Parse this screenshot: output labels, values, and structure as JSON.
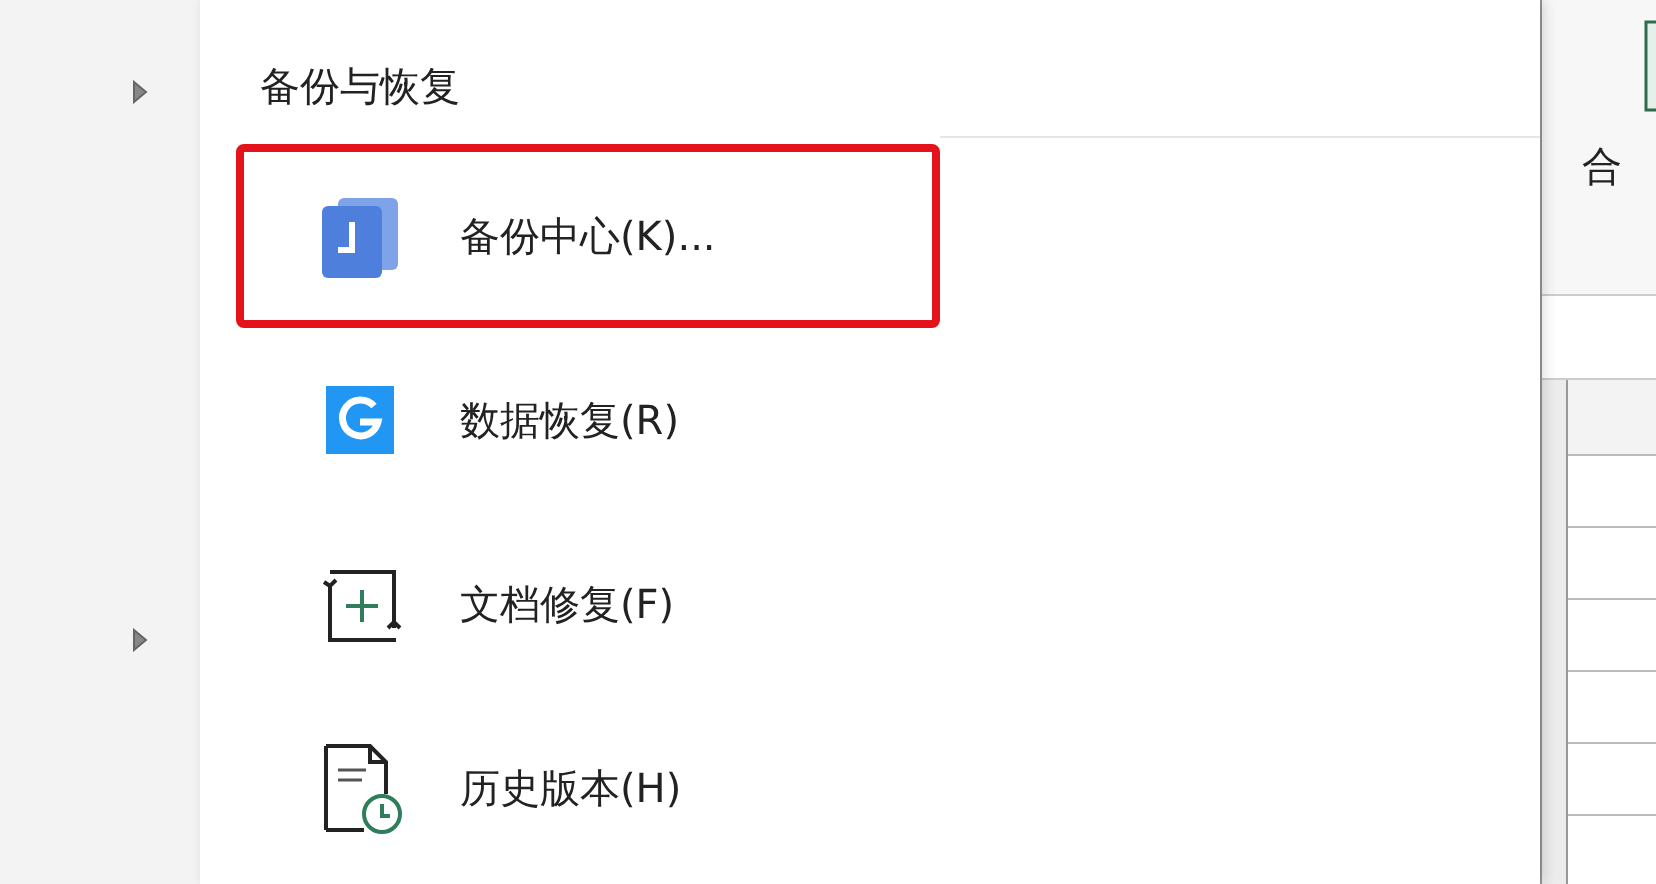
{
  "submenu": {
    "title": "备份与恢复",
    "items": [
      {
        "kind": "backup",
        "label": "备份中心(K)...",
        "highlighted": true
      },
      {
        "kind": "recover",
        "label": "数据恢复(R)",
        "highlighted": false
      },
      {
        "kind": "repair",
        "label": "文档修复(F)",
        "highlighted": false
      },
      {
        "kind": "history",
        "label": "历史版本(H)",
        "highlighted": false
      }
    ]
  },
  "ribbon": {
    "label": "合"
  }
}
